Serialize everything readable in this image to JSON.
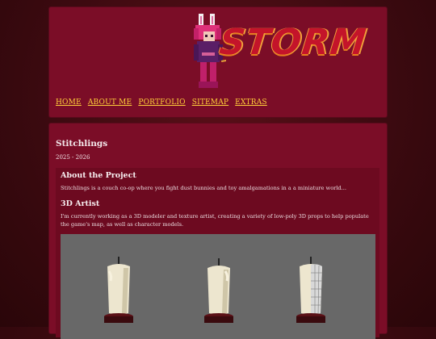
{
  "nav": {
    "items": [
      "HOME",
      "ABOUT ME",
      "PORTFOLIO",
      "SITEMAP",
      "EXTRAS"
    ]
  },
  "logo": {
    "text": "STORM",
    "colors": {
      "fill": "#c4142a",
      "outline": "#f0a23a"
    }
  },
  "project": {
    "title": "Stitchlings",
    "years": "2025 - 2026",
    "about_heading": "About the Project",
    "about_text": "Stitchlings is a couch co-op where you fight dust bunnies and toy amalgamations in a a miniature world...",
    "role_heading": "3D Artist",
    "role_text": "I'm currently working as a 3D modeler and texture artist, creating a variety of low-poly 3D props to help populate the game's map, as well as character models."
  },
  "colors": {
    "page_bg": "#3c0a10",
    "panel_bg": "#7b0d27",
    "inner_bg": "#6d0a20",
    "nav_link": "#ffcf3a",
    "render_bg": "#686868"
  }
}
